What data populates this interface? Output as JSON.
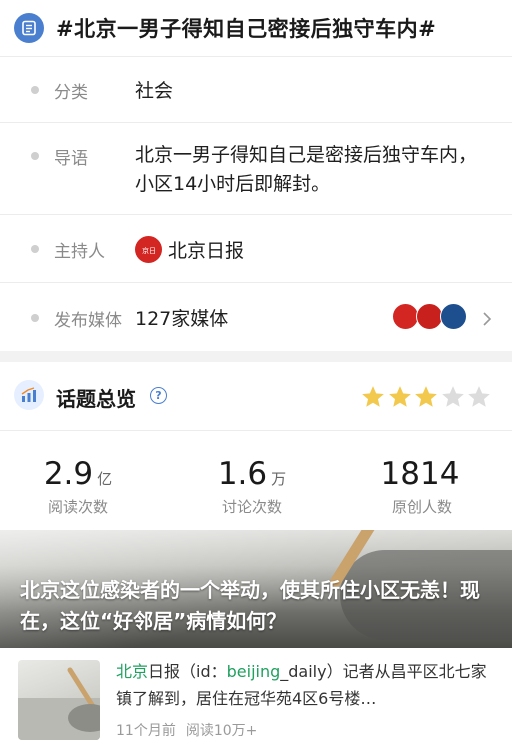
{
  "header": {
    "title": "#北京一男子得知自己密接后独守车内#",
    "icon": "list-icon",
    "accent": "#4a7fd0"
  },
  "info": {
    "category": {
      "label": "分类",
      "value": "社会"
    },
    "intro": {
      "label": "导语",
      "value": "北京一男子得知自己是密接后独守车内，小区14小时后即解封。"
    },
    "host": {
      "label": "主持人",
      "value": "北京日报",
      "logo": "beijing-daily-logo"
    },
    "media": {
      "label": "发布媒体",
      "value": "127家媒体",
      "logos": [
        "beijing-daily-logo",
        "beijing-evening-logo",
        "china-news-weekly-logo"
      ]
    }
  },
  "overview": {
    "title": "话题总览",
    "icon": "chart-icon",
    "help_icon": "help-icon",
    "rating": 3,
    "rating_max": 5,
    "star_color": "#f2c94c"
  },
  "stats": [
    {
      "value": "2.9",
      "unit": "亿",
      "label": "阅读次数"
    },
    {
      "value": "1.6",
      "unit": "万",
      "label": "讨论次数"
    },
    {
      "value": "1814",
      "unit": "",
      "label": "原创人数"
    }
  ],
  "banner": {
    "title": "北京这位感染者的一个举动，使其所住小区无恙！现在，这位“好邻居”病情如何？"
  },
  "news": {
    "text_hl1": "北京",
    "text_part2": "日报（id：",
    "text_hl2": "beijing",
    "text_part3": "_daily）记者从昌平区北七家镇了解到，居住在冠华苑4区6号楼…",
    "time": "11个月前",
    "reads": "阅读10万+",
    "highlight_color": "#20a160"
  }
}
